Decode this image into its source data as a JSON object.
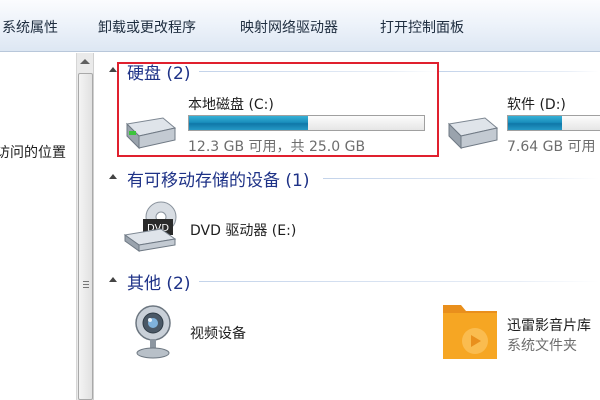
{
  "toolbar": {
    "items": [
      "系统属性",
      "卸载或更改程序",
      "映射网络驱动器",
      "打开控制面板"
    ]
  },
  "nav": {
    "partial_text": "访问的位置"
  },
  "groups": {
    "hdd": {
      "title": "硬盘 (2)",
      "drives": [
        {
          "name": "本地磁盘 (C:)",
          "space": "12.3 GB 可用，共 25.0 GB",
          "used_fraction": 0.508
        },
        {
          "name": "软件 (D:)",
          "space": "7.64 GB 可用",
          "used_fraction": 0.5
        }
      ]
    },
    "removable": {
      "title": "有可移动存储的设备 (1)",
      "device_name": "DVD 驱动器 (E:)",
      "dvd_label": "DVD"
    },
    "other": {
      "title": "其他 (2)",
      "items": [
        {
          "name": "视频设备",
          "sub": ""
        },
        {
          "name": "迅雷影音片库",
          "sub": "系统文件夹"
        }
      ]
    }
  },
  "colors": {
    "group_title": "#1e3287",
    "selection": "#e0202e",
    "bar_fill": "#1a8fbd"
  }
}
